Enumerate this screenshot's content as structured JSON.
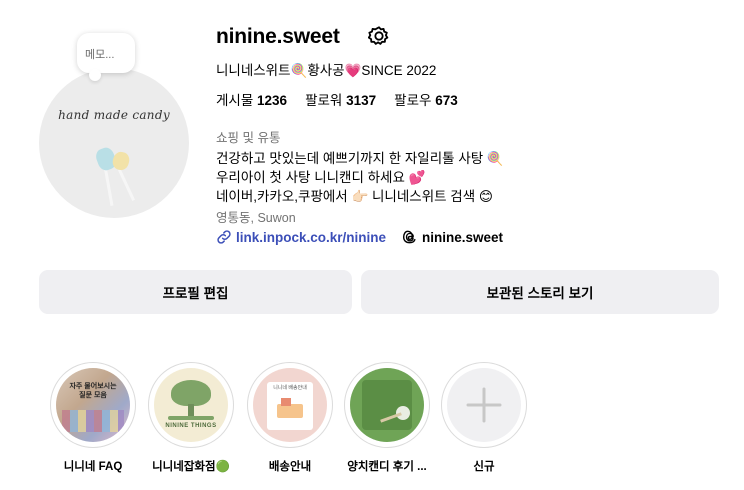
{
  "note": {
    "text": "메모..."
  },
  "avatar": {
    "script_text": "hand made candy"
  },
  "profile": {
    "username": "ninine.sweet",
    "full_name": "니니네스위트🍭황사공💗SINCE 2022",
    "stats": [
      {
        "label": "게시물",
        "value": "1236"
      },
      {
        "label": "팔로워",
        "value": "3137"
      },
      {
        "label": "팔로우",
        "value": "673"
      }
    ],
    "category": "쇼핑 및 유통",
    "bio_lines": [
      "건강하고 맛있는데 예쁘기까지 한 자일리톨 사탕 🍭",
      "우리아이 첫 사탕 니니캔디 하세요 💕",
      "네이버,카카오,쿠팡에서 👉🏻 니니네스위트 검색 😊"
    ],
    "location": "영통동, Suwon",
    "link": "link.inpock.co.kr/ninine",
    "threads_handle": "ninine.sweet"
  },
  "buttons": {
    "edit_profile": "프로필 편집",
    "view_archive": "보관된 스토리 보기"
  },
  "highlights": [
    {
      "label": "니니네 FAQ",
      "cover_text": "자주 물어보시는 질문 모음"
    },
    {
      "label": "니니네잡화점🟢",
      "cover_text": "NININE THINGS"
    },
    {
      "label": "배송안내",
      "cover_text": "니니네 배송안내"
    },
    {
      "label": "양치캔디 후기 ..."
    },
    {
      "label": "신규"
    }
  ],
  "colors": {
    "link": "#3c4fb8",
    "button_bg": "#efeff2",
    "secondary_text": "#737373"
  }
}
